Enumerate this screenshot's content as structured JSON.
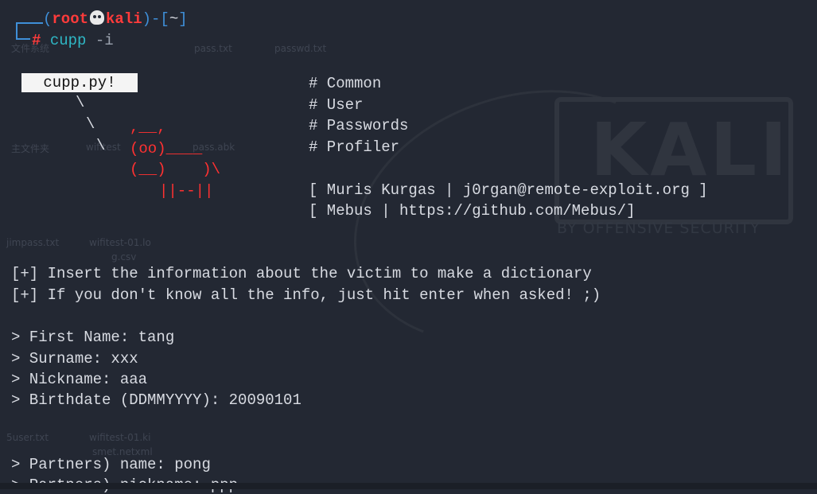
{
  "background": {
    "desktop_labels": [
      "文件系统",
      "pass.txt",
      "主文件夹",
      "wifitest",
      "passwd.txt",
      "pass.abk",
      "jimpass.txt",
      "wifitest-01.lo",
      "g.csv",
      "5user.txt",
      "wifitest-01.ki",
      "smet.netxml"
    ],
    "watermark": {
      "brand": "KALI",
      "tagline": "BY OFFENSIVE SECURITY"
    }
  },
  "prompt": {
    "user": "root",
    "host": "kali",
    "cwd": "~",
    "command": "cupp",
    "flag": "-i"
  },
  "banner": {
    "bubble": "cupp.py!",
    "ascii_lines": [
      "\\",
      "\\",
      "\\",
      ",__,",
      "(oo)____",
      "(__)    )\\",
      "||--||"
    ],
    "tags": [
      "# Common",
      "# User",
      "# Passwords",
      "# Profiler"
    ],
    "credits": [
      "[ Muris Kurgas | j0rgan@remote-exploit.org ]",
      "[ Mebus | https://github.com/Mebus/]"
    ]
  },
  "info": [
    "[+] Insert the information about the victim to make a dictionary",
    "[+] If you don't know all the info, just hit enter when asked! ;)"
  ],
  "prompts": [
    "> First Name: tang",
    "> Surname: xxx",
    "> Nickname: aaa",
    "> Birthdate (DDMMYYYY): 20090101",
    "> Partners) name: pong",
    "> Partners) nickname: ppp"
  ],
  "colors": {
    "background": "#232833",
    "text": "#d8dbe2",
    "accent_red": "#ff3b3b",
    "accent_blue": "#3f8fd8",
    "command_cyan": "#2fb7c5"
  }
}
